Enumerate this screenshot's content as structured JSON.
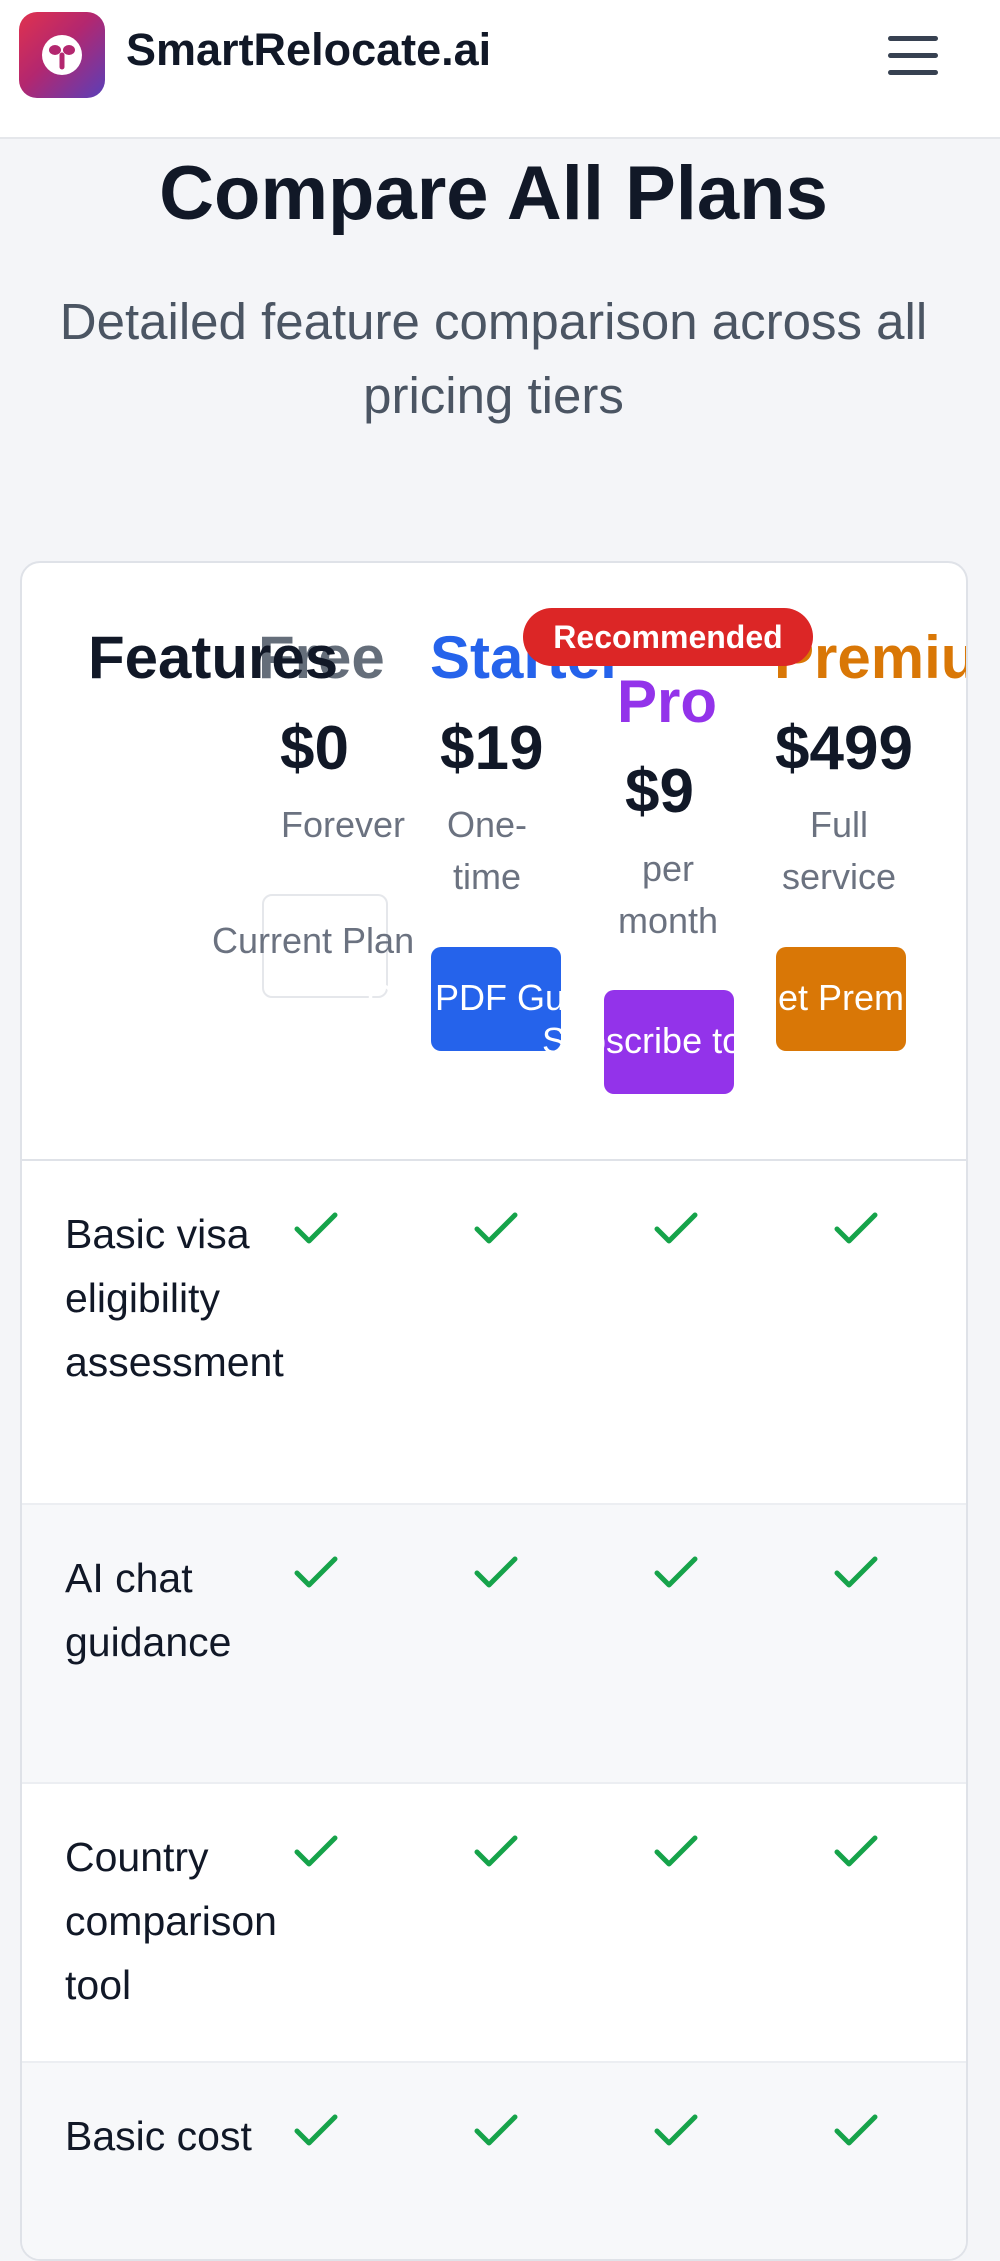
{
  "header": {
    "brand": "SmartRelocate.ai",
    "logo_icon": "sprout-icon",
    "menu_icon": "hamburger-menu-icon"
  },
  "main": {
    "title": "Compare All Plans",
    "subtitle": "Detailed feature comparison across all pricing tiers"
  },
  "table": {
    "features_header": "Features",
    "recommended_badge": "Recommended",
    "plans": [
      {
        "name": "Free",
        "price": "$0",
        "period": "Forever",
        "button": "Current Plan",
        "color": "#4b5563"
      },
      {
        "name": "Starter",
        "price": "$19",
        "period": "One-time",
        "button": "Get PDF Guide",
        "color": "#2563eb"
      },
      {
        "name": "Pro",
        "price": "$9",
        "period": "per month",
        "button": "Subscribe to Pro",
        "color": "#9333ea"
      },
      {
        "name": "Premium",
        "price": "$499",
        "period": "Full service",
        "button": "Get Premium",
        "color": "#d97706"
      }
    ],
    "rows": [
      {
        "label": "Basic visa eligibility assessment",
        "checks": [
          true,
          true,
          true,
          true
        ]
      },
      {
        "label": "AI chat guidance",
        "checks": [
          true,
          true,
          true,
          true
        ]
      },
      {
        "label": "Country comparison tool",
        "checks": [
          true,
          true,
          true,
          true
        ]
      },
      {
        "label": "Basic cost",
        "checks": [
          true,
          true,
          true,
          true
        ]
      }
    ],
    "check_color": "#16a34a",
    "check_icon": "check-icon"
  }
}
